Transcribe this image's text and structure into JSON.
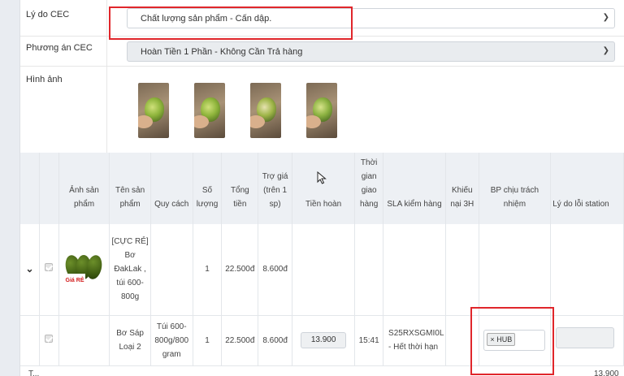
{
  "form": {
    "reason": {
      "label": "Lý do CEC",
      "value": "Chất lượng sản phẩm - Cấn dập."
    },
    "plan": {
      "label": "Phương án CEC",
      "value": "Hoàn Tiền 1 Phần - Không Cần Trả hàng"
    },
    "images": {
      "label": "Hình ảnh",
      "count": 4
    }
  },
  "table": {
    "columns": [
      "",
      "",
      "Ảnh sản phẩm",
      "Tên sản phẩm",
      "Quy cách",
      "Số lượng",
      "Tổng tiền",
      "Trợ giá (trên 1 sp)",
      "Tiền hoàn",
      "Thời gian giao hàng",
      "SLA kiểm hàng",
      "Khiếu nại 3H",
      "BP chịu trách nhiệm",
      "Lý do lỗi station"
    ],
    "rows": [
      {
        "image_badge": "Giá RẺ",
        "name": "[CỰC RẺ] Bơ ĐakLak , túi 600-800g",
        "spec": "",
        "qty": "1",
        "total": "22.500đ",
        "subsidy": "8.600đ",
        "refund": "",
        "delivery_time": "",
        "sla": "",
        "complaint": "",
        "responsible": ""
      },
      {
        "name": "Bơ Sáp Loại 2",
        "spec": "Túi 600-800g/800 gram",
        "qty": "1",
        "total": "22.500đ",
        "subsidy": "8.600đ",
        "refund": "13.900",
        "delivery_time": "15:41",
        "sla": "S25RXSGMI0L - Hết thời hạn",
        "complaint": "",
        "responsible_tag": "HUB",
        "tag_remove": "×"
      }
    ],
    "footer_left": "T...",
    "footer_right": "13.900"
  },
  "icons": {
    "dropdown": "chevron-down-icon",
    "expand": "chevron-down-icon",
    "cursor": "mouse-pointer-icon"
  },
  "colors": {
    "highlight": "#e0262b",
    "header_bg": "#edf0f4"
  }
}
